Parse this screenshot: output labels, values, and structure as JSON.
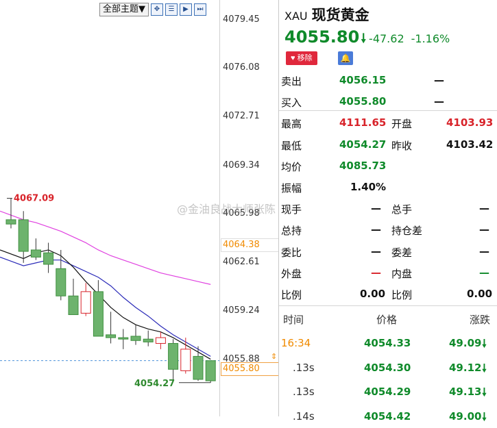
{
  "toolbar": {
    "theme_label": "全部主题▼",
    "icons": [
      "grid-icon",
      "list-icon",
      "play-icon",
      "play-end-icon"
    ]
  },
  "chart_data": {
    "type": "candlestick",
    "y_ticks": [
      "4079.45",
      "4076.08",
      "4072.71",
      "4069.34",
      "4065.98",
      "4062.61",
      "4059.24",
      "4055.88"
    ],
    "ylim": [
      4053.5,
      4080.5
    ],
    "high_label": "4067.09",
    "low_label": "4054.27",
    "horizontal_line_label": "4064.38",
    "current_price_label": "4055.80",
    "candles": [
      {
        "o": 4065.6,
        "h": 4067.09,
        "l": 4065.0,
        "c": 4065.3
      },
      {
        "o": 4065.6,
        "h": 4066.2,
        "l": 4062.6,
        "c": 4063.4
      },
      {
        "o": 4063.5,
        "h": 4064.3,
        "l": 4062.8,
        "c": 4063.0
      },
      {
        "o": 4063.3,
        "h": 4064.0,
        "l": 4061.9,
        "c": 4062.5
      },
      {
        "o": 4062.2,
        "h": 4063.5,
        "l": 4060.0,
        "c": 4060.3
      },
      {
        "o": 4060.3,
        "h": 4061.5,
        "l": 4059.1,
        "c": 4059.0
      },
      {
        "o": 4059.1,
        "h": 4061.2,
        "l": 4058.9,
        "c": 4060.6
      },
      {
        "o": 4060.6,
        "h": 4061.4,
        "l": 4058.7,
        "c": 4057.5
      },
      {
        "o": 4057.6,
        "h": 4059.2,
        "l": 4057.0,
        "c": 4057.4
      },
      {
        "o": 4057.4,
        "h": 4058.0,
        "l": 4056.6,
        "c": 4057.3
      },
      {
        "o": 4057.5,
        "h": 4058.3,
        "l": 4056.9,
        "c": 4057.2
      },
      {
        "o": 4057.3,
        "h": 4057.9,
        "l": 4056.8,
        "c": 4057.1
      },
      {
        "o": 4057.0,
        "h": 4057.8,
        "l": 4056.6,
        "c": 4057.4
      },
      {
        "o": 4057.0,
        "h": 4057.3,
        "l": 4054.4,
        "c": 4055.2
      },
      {
        "o": 4055.1,
        "h": 4057.4,
        "l": 4054.9,
        "c": 4056.6
      },
      {
        "o": 4056.1,
        "h": 4056.8,
        "l": 4054.4,
        "c": 4054.5
      },
      {
        "o": 4055.8,
        "h": 4055.8,
        "l": 4054.27,
        "c": 4054.4
      }
    ],
    "ma_black": [
      4062.9,
      4063.3,
      4063.5,
      4063.1,
      4062.3,
      4061.3,
      4060.4,
      4059.5,
      4058.8,
      4058.3,
      4058.0,
      4057.8,
      4057.4,
      4056.9,
      4056.4,
      4055.9
    ],
    "ma_blue": [
      4062.4,
      4062.6,
      4062.8,
      4062.8,
      4062.4,
      4062.0,
      4061.6,
      4061.0,
      4060.2,
      4059.5,
      4058.9,
      4058.2,
      4057.6,
      4057.1,
      4056.6,
      4056.1
    ],
    "ma_magenta": [
      4065.6,
      4065.4,
      4065.1,
      4064.8,
      4064.4,
      4064.0,
      4063.5,
      4063.1,
      4062.8,
      4062.5,
      4062.2,
      4061.9,
      4061.7,
      4061.5,
      4061.3,
      4061.1
    ],
    "grid": false
  },
  "quote": {
    "code": "XAU",
    "name": "现货黄金",
    "last": "4055.80",
    "change": "-47.62",
    "change_pct": "-1.16%",
    "remove_label": "移除",
    "rows": [
      {
        "l1": "卖出",
        "v1": "4056.15",
        "v1c": "green",
        "l2": "",
        "v2": "—",
        "v2c": "dash"
      },
      {
        "l1": "买入",
        "v1": "4055.80",
        "v1c": "green",
        "l2": "",
        "v2": "—",
        "v2c": "dash"
      },
      {
        "l1": "最高",
        "v1": "4111.65",
        "v1c": "red",
        "l2": "开盘",
        "v2": "4103.93",
        "v2c": "red"
      },
      {
        "l1": "最低",
        "v1": "4054.27",
        "v1c": "green",
        "l2": "昨收",
        "v2": "4103.42",
        "v2c": "black"
      },
      {
        "l1": "均价",
        "v1": "4085.73",
        "v1c": "green",
        "l2": "",
        "v2": "",
        "v2c": "black"
      },
      {
        "l1": "振幅",
        "v1": "1.40%",
        "v1c": "black",
        "l2": "",
        "v2": "",
        "v2c": "black"
      },
      {
        "l1": "现手",
        "v1": "—",
        "v1c": "dash",
        "l2": "总手",
        "v2": "—",
        "v2c": "dash"
      },
      {
        "l1": "总持",
        "v1": "—",
        "v1c": "dash",
        "l2": "持仓差",
        "v2": "—",
        "v2c": "dash"
      },
      {
        "l1": "委比",
        "v1": "—",
        "v1c": "dash",
        "l2": "委差",
        "v2": "—",
        "v2c": "dash"
      },
      {
        "l1": "外盘",
        "v1": "—",
        "v1c": "dash-red",
        "l2": "内盘",
        "v2": "—",
        "v2c": "dash-green"
      },
      {
        "l1": "比例",
        "v1": "0.00",
        "v1c": "black",
        "l2": "比例",
        "v2": "0.00",
        "v2c": "black"
      }
    ]
  },
  "ticks": {
    "headers": {
      "time": "时间",
      "price": "价格",
      "change": "涨跌"
    },
    "rows": [
      {
        "time": "16:34",
        "price": "4054.33",
        "change": "49.09",
        "time_color": "#f08a00"
      },
      {
        "time": ".13s",
        "price": "4054.30",
        "change": "49.12",
        "time_color": "#333"
      },
      {
        "time": ".13s",
        "price": "4054.29",
        "change": "49.13",
        "time_color": "#333"
      },
      {
        "time": ".14s",
        "price": "4054.42",
        "change": "49.00",
        "time_color": "#333"
      }
    ]
  },
  "watermark": "@金油良战大师张陈"
}
